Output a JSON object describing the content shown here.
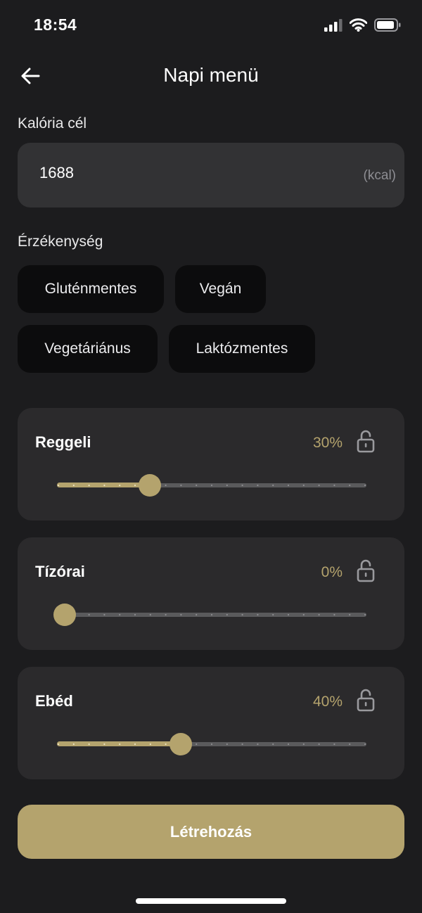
{
  "status_bar": {
    "time": "18:54"
  },
  "header": {
    "title": "Napi menü"
  },
  "calorie": {
    "label": "Kalória cél",
    "value": "1688",
    "unit": "(kcal)"
  },
  "sensitivity": {
    "label": "Érzékenység",
    "chips": [
      "Gluténmentes",
      "Vegán",
      "Vegetáriánus",
      "Laktózmentes"
    ]
  },
  "meals": [
    {
      "name": "Reggeli",
      "percent_label": "30%",
      "value": 30
    },
    {
      "name": "Tízórai",
      "percent_label": "0%",
      "value": 0
    },
    {
      "name": "Ebéd",
      "percent_label": "40%",
      "value": 40
    }
  ],
  "create_button": {
    "label": "Létrehozás"
  },
  "colors": {
    "accent": "#b4a36d",
    "background": "#1c1c1e",
    "card": "#2b2a2c",
    "chip": "#0c0c0d",
    "field": "#323234"
  },
  "icons": {
    "back": "arrow-left-icon",
    "lock": "lock-open-icon",
    "signal": "signal-icon",
    "wifi": "wifi-icon",
    "battery": "battery-icon"
  }
}
